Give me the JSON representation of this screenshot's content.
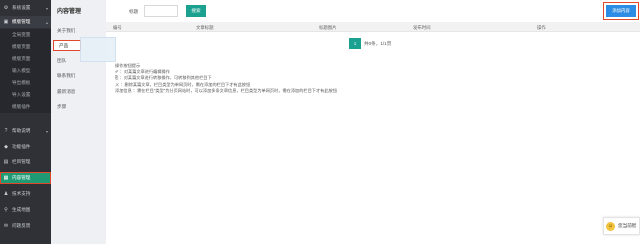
{
  "sidebar": {
    "items": [
      {
        "icon": "gear-icon",
        "glyph": "⚙",
        "label": "系统设置",
        "arrow": "▾"
      },
      {
        "icon": "module-icon",
        "glyph": "▣",
        "label": "模版管理",
        "arrow": "▴"
      },
      {
        "label": "全局变量"
      },
      {
        "label": "模版页面"
      },
      {
        "label": "模版页面"
      },
      {
        "label": "输入模型"
      },
      {
        "label": "导出模板"
      },
      {
        "label": "导入设置"
      },
      {
        "label": "模版插件"
      },
      {
        "icon": "help-icon",
        "glyph": "?",
        "label": "帮助说明",
        "arrow": "▾"
      },
      {
        "icon": "plugin-icon",
        "glyph": "◆",
        "label": "功能插件"
      },
      {
        "icon": "column-icon",
        "glyph": "▤",
        "label": "栏目管理"
      },
      {
        "icon": "content-icon",
        "glyph": "▦",
        "label": "内容管理"
      },
      {
        "icon": "support-icon",
        "glyph": "♟",
        "label": "技术支持"
      },
      {
        "icon": "sitemap-icon",
        "glyph": "⚲",
        "label": "生成地图"
      },
      {
        "icon": "feedback-icon",
        "glyph": "✉",
        "label": "问题反馈"
      }
    ]
  },
  "panel": {
    "title": "内容管理",
    "items": [
      "关于我们",
      "产品",
      "团队",
      "联系我们",
      "最新消息",
      "步骤"
    ]
  },
  "toolbar": {
    "search_label": "标题",
    "search_value": "",
    "search_button": "搜索",
    "add_button": "添加内容"
  },
  "table": {
    "headers": [
      "编号",
      "文章标题",
      "标题图片",
      "发布时间",
      "操作"
    ]
  },
  "pager": {
    "current": "1",
    "info": "共0条，1/1页"
  },
  "tips": {
    "title": "操作按钮提示",
    "lines": [
      "✐ ：对某篇文章进行编辑操作",
      "⎘ ：对某篇文章进行转移操作，可转移到其他栏目下",
      "ㄨ ：删除某篇文章，栏目类型为单网页时，需在添加的栏目下才有此按钮",
      "添加信息 ：需在栏目\"类型\"为分页网站时，可以添加多条文章信息，栏目类型为单网页时，需在添加的栏目下才有此按钮"
    ]
  },
  "widget": {
    "icon": "smiley-icon",
    "glyph": "☺",
    "text": "您当前智"
  }
}
